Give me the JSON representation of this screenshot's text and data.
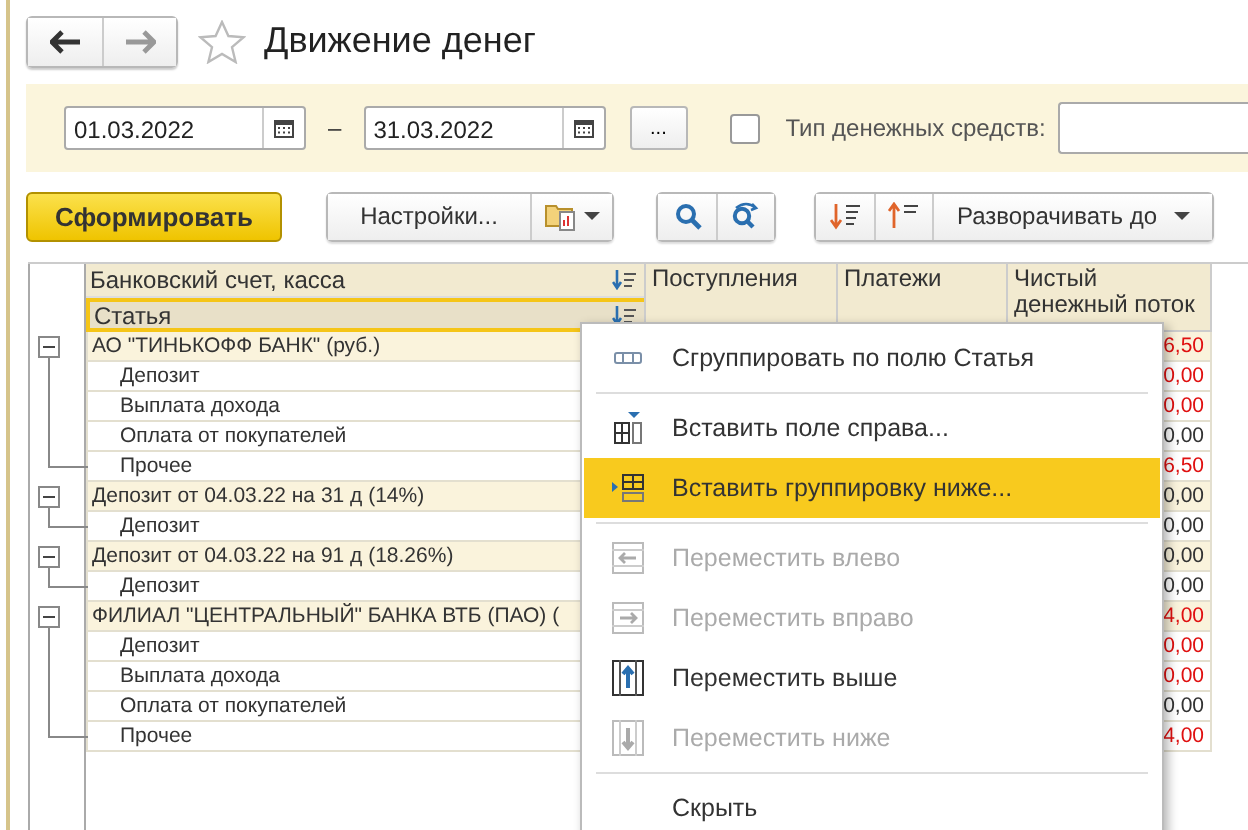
{
  "window": {
    "title": "Движение денег",
    "favorite": false
  },
  "period": {
    "start": "01.03.2022",
    "separator": "–",
    "end": "31.03.2022",
    "more_button": "..."
  },
  "cash_type": {
    "label": "Тип денежных средств:",
    "checked": false
  },
  "toolbar": {
    "generate": "Сформировать",
    "settings": "Настройки...",
    "expand": "Разворачивать до"
  },
  "table": {
    "grouping_headers": [
      {
        "label": "Банковский счет, касса",
        "selected": false
      },
      {
        "label": "Статья",
        "selected": true
      }
    ],
    "columns": [
      "Поступления",
      "Платежи",
      "Чистый денежный поток"
    ],
    "rows": [
      {
        "label": "АО \"ТИНЬКОФФ БАНК\" (руб.)",
        "net": "6,50",
        "negative": true,
        "expanded": true,
        "children": [
          {
            "label": "Депозит",
            "net": "0,00",
            "negative": true
          },
          {
            "label": "Выплата дохода",
            "net": "0,00",
            "negative": true
          },
          {
            "label": "Оплата от покупателей",
            "net": "0,00",
            "negative": false
          },
          {
            "label": "Прочее",
            "net": "6,50",
            "negative": true
          }
        ]
      },
      {
        "label": "Депозит от 04.03.22 на 31 д (14%)",
        "net": "0,00",
        "negative": false,
        "expanded": true,
        "children": [
          {
            "label": "Депозит",
            "net": "0,00",
            "negative": false
          }
        ]
      },
      {
        "label": "Депозит от 04.03.22 на 91 д (18.26%)",
        "net": "0,00",
        "negative": false,
        "expanded": true,
        "children": [
          {
            "label": "Депозит",
            "net": "0,00",
            "negative": false
          }
        ]
      },
      {
        "label": "ФИЛИАЛ \"ЦЕНТРАЛЬНЫЙ\" БАНКА ВТБ (ПАО) (",
        "net": "4,00",
        "negative": true,
        "expanded": true,
        "children": [
          {
            "label": "Депозит",
            "net": "0,00",
            "negative": true
          },
          {
            "label": "Выплата дохода",
            "net": "0,00",
            "negative": true
          },
          {
            "label": "Оплата от покупателей",
            "net": "0,00",
            "negative": false
          },
          {
            "label": "Прочее",
            "net": "4,00",
            "negative": true
          }
        ]
      }
    ]
  },
  "context_menu": {
    "items": [
      {
        "kind": "group",
        "label": "Сгруппировать по полю Статья",
        "disabled": false,
        "selected": false
      },
      {
        "kind": "separator"
      },
      {
        "kind": "insert-field",
        "label": "Вставить поле справа...",
        "disabled": false,
        "selected": false
      },
      {
        "kind": "insert-grouping",
        "label": "Вставить группировку ниже...",
        "disabled": false,
        "selected": true
      },
      {
        "kind": "separator"
      },
      {
        "kind": "move-left",
        "label": "Переместить влево",
        "disabled": true,
        "selected": false
      },
      {
        "kind": "move-right",
        "label": "Переместить вправо",
        "disabled": true,
        "selected": false
      },
      {
        "kind": "move-up",
        "label": "Переместить выше",
        "disabled": false,
        "selected": false
      },
      {
        "kind": "move-down",
        "label": "Переместить ниже",
        "disabled": true,
        "selected": false
      },
      {
        "kind": "separator"
      },
      {
        "kind": "hide",
        "label": "Скрыть",
        "disabled": false,
        "selected": false
      }
    ]
  }
}
